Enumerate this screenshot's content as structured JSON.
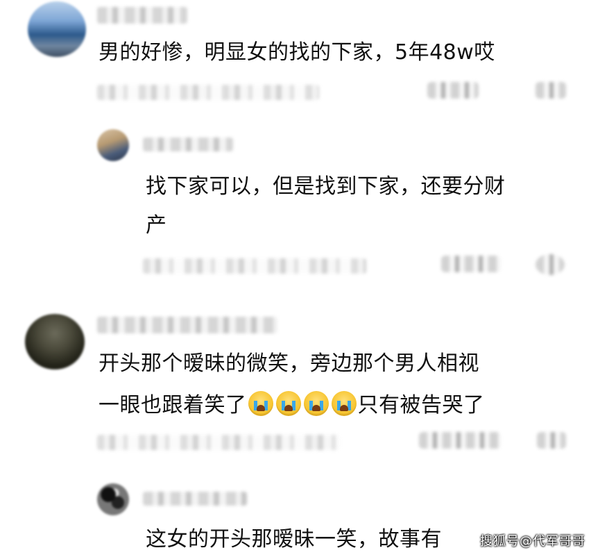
{
  "comments": [
    {
      "text": "男的好惨，明显女的找的下家，5年48w哎"
    },
    {
      "text": "找下家可以，但是找到下家，还要分财产",
      "line1": "找下家可以，但是找到下家，还要分财",
      "line2": "产"
    },
    {
      "line1": "开头那个暧昧的微笑，旁边那个男人相视",
      "line2_before": "一眼也跟着笑了",
      "line2_emoji_count": 4,
      "line2_emoji_name": "crying-face-icon",
      "line2_after": "只有被告哭了"
    },
    {
      "text": "这女的开头那暧昧一笑，故事有"
    }
  ],
  "watermark": "搜狐号@代军哥哥",
  "colors": {
    "text": "#111111",
    "background": "#ffffff",
    "emoji_yellow": "#f7c531",
    "tear_blue": "#3aa7e8"
  }
}
